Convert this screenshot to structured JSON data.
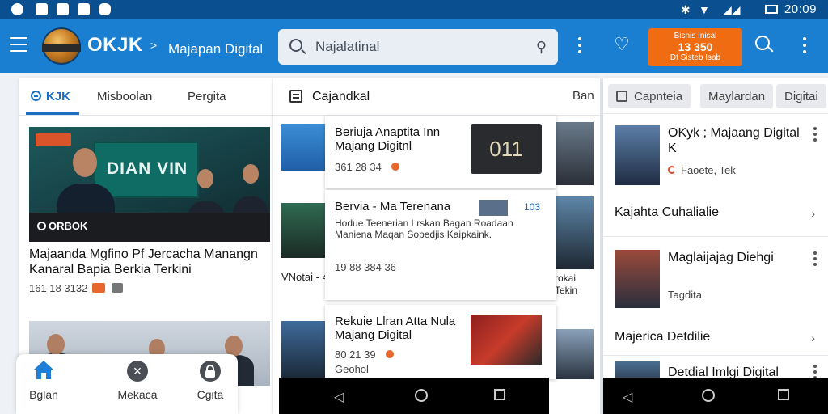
{
  "status_bar": {
    "time": "20:09"
  },
  "app_bar": {
    "brand": "OKJK",
    "breadcrumb": "Majapan Digital",
    "search_placeholder": "Najalatinal",
    "promo": {
      "line1": "Bisnis Inisal",
      "line2": "13 350",
      "line3": "Dt Sisteb Isab"
    }
  },
  "left_panel": {
    "tabs": [
      {
        "label": "KJK"
      },
      {
        "label": "Misboolan"
      },
      {
        "label": "Pergita"
      }
    ],
    "hero_watermark": "ORBOK",
    "hero_screen_text": "DIAN VIN",
    "article_title": "Majaanda Mgfino Pf Jercacha Manangn Kanaral Bapia Berkia Terkini",
    "article_meta": "161 18 3132"
  },
  "bottom_nav": {
    "items": [
      {
        "label": "Bglan",
        "icon": "home-icon"
      },
      {
        "label": "Mekaca",
        "icon": "close-icon"
      },
      {
        "label": "Cgita",
        "icon": "lock-icon"
      }
    ]
  },
  "center_panel": {
    "title": "Cajandkal",
    "left_caption": "VNotai - 4",
    "right_top_label": "Ban",
    "right_caption": "rokai Tekin",
    "cards": [
      {
        "title": "Beriuja Anaptita Inn Majang Digitnl",
        "meta": "361 28 34",
        "thumb_text": "011"
      },
      {
        "title": "Bervia - Ma Terenana",
        "body": "Hodue Teenerian Lrskan Bagan Roadaan Maniena Maqan Sopedjis Kaipkaink.",
        "meta": "19 88 384 36",
        "thumb_tag": "103"
      },
      {
        "title": "Rekuie Llran Atta Nula Majang Digital",
        "meta": "80 21 39",
        "sub": "Geohol"
      }
    ]
  },
  "right_panel": {
    "chips": [
      {
        "label": "Capnteia"
      },
      {
        "label": "Maylardan"
      },
      {
        "label": "Digitai"
      }
    ],
    "items": [
      {
        "title": "OKyk ; Majaang Digital K",
        "meta": "Faoete, Tek"
      },
      {
        "link": "Kajahta Cuhalialie"
      },
      {
        "title": "Maglaijajag Diehgi",
        "meta": "Tagdita"
      },
      {
        "link": "Majerica Detdilie"
      },
      {
        "title": "Detdial Imlgi Digital"
      }
    ]
  },
  "colors": {
    "primary": "#1a7fd0",
    "status": "#0a4f8f",
    "accent": "#ef6c13"
  }
}
